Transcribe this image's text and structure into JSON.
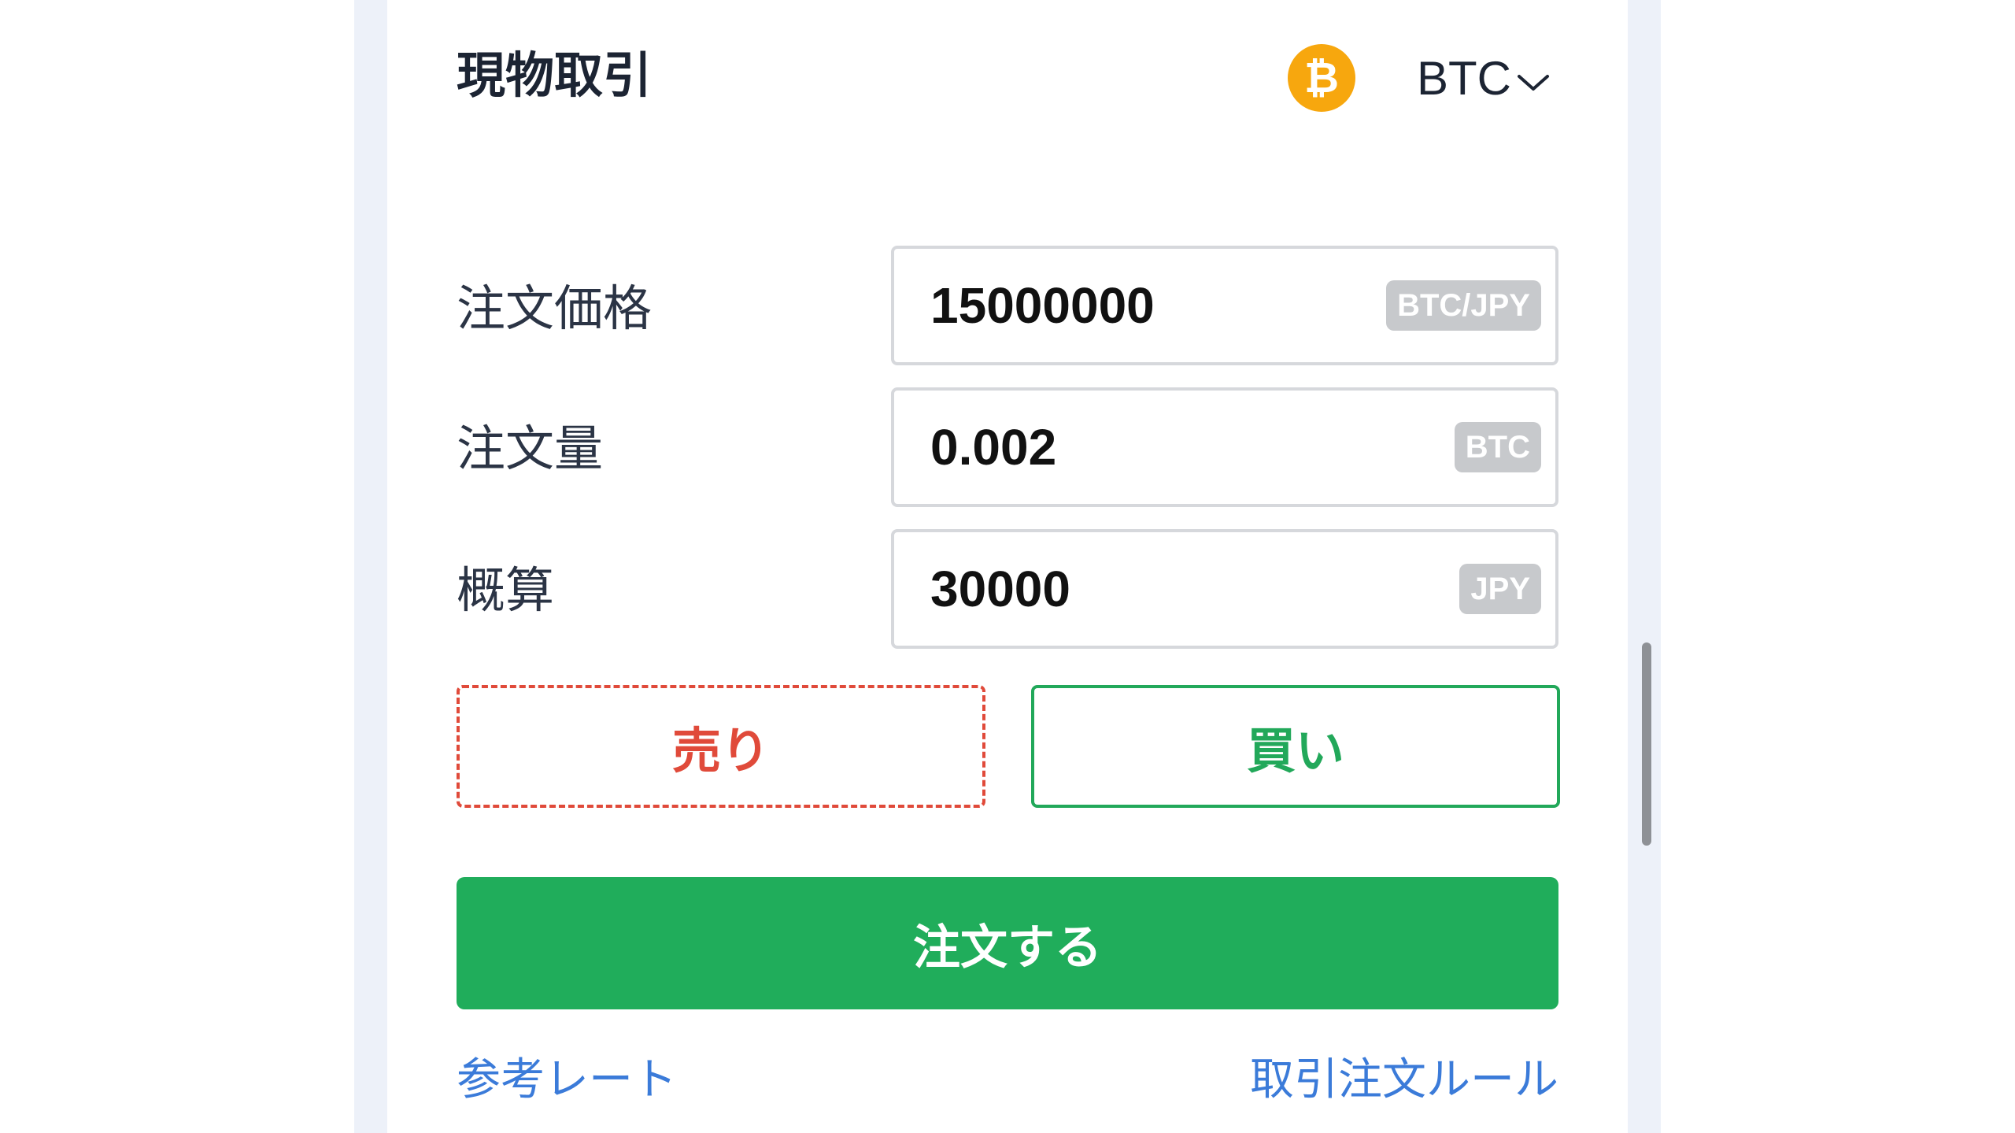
{
  "header": {
    "title": "現物取引",
    "coin_icon_glyph": "₿",
    "coin_symbol": "BTC",
    "coin_icon_color": "#f7a70e"
  },
  "form": {
    "fields": [
      {
        "label": "注文価格",
        "value": "15000000",
        "unit": "BTC/JPY"
      },
      {
        "label": "注文量",
        "value": "0.002",
        "unit": "BTC"
      },
      {
        "label": "概算",
        "value": "30000",
        "unit": "JPY"
      }
    ]
  },
  "side": {
    "sell_label": "売り",
    "buy_label": "買い",
    "sell_color": "#e04a3a",
    "buy_color": "#22a85a"
  },
  "actions": {
    "order_label": "注文する",
    "order_color": "#20ad5b"
  },
  "links": {
    "reference_rate": "参考レート",
    "trading_rules": "取引注文ルール",
    "link_color": "#3b7bd9"
  },
  "icons": {
    "coin": "bitcoin-icon",
    "selector_chevron": "chevron-down-icon"
  }
}
